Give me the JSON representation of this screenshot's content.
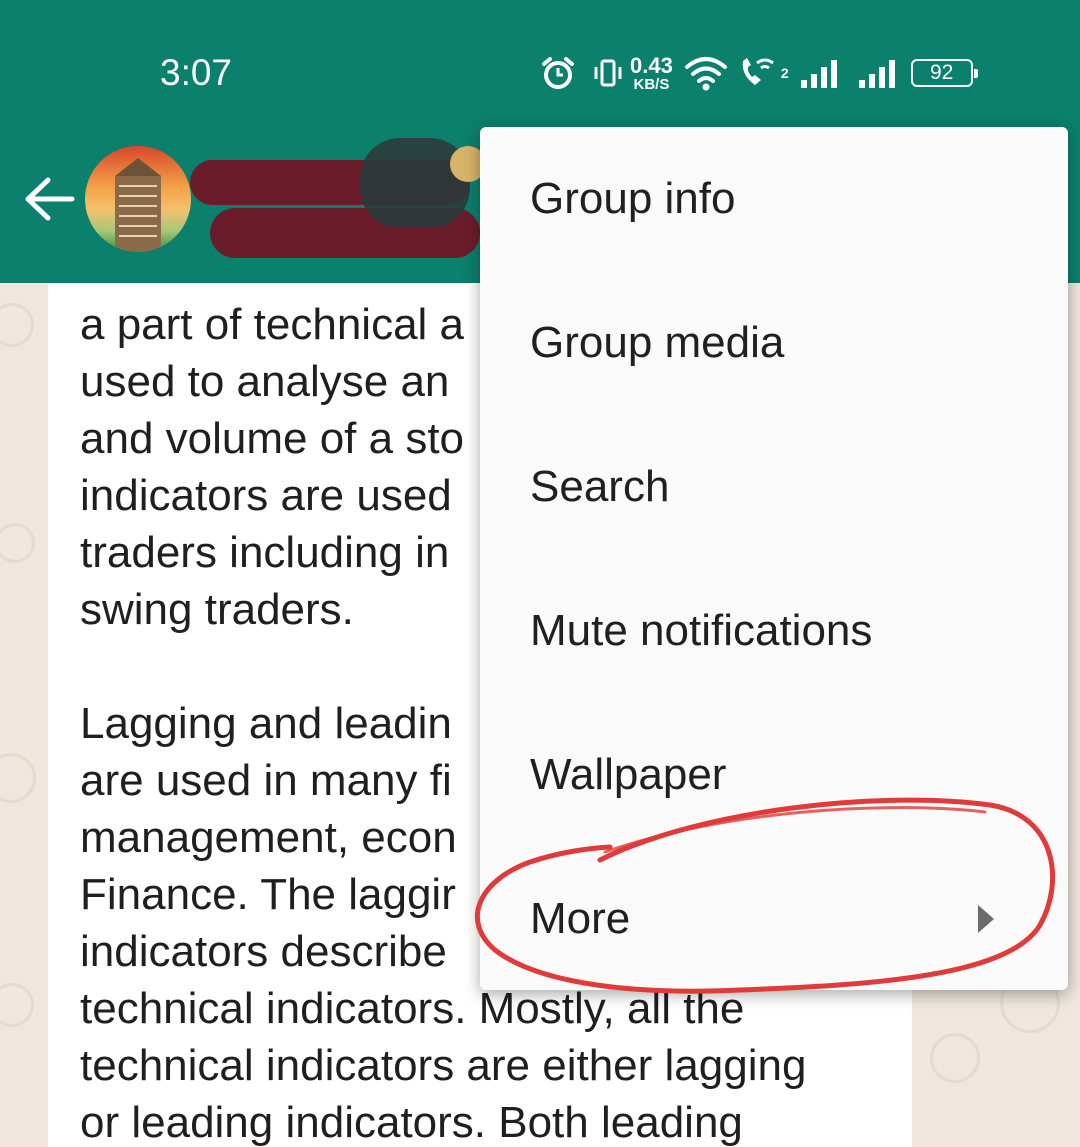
{
  "status_bar": {
    "time": "3:07",
    "net_speed_value": "0.43",
    "net_speed_unit": "KB/S",
    "battery_level": "92",
    "sim_label": "2"
  },
  "toolbar": {
    "back_icon": "arrow-left-icon"
  },
  "message": {
    "text": "a part of technical a\nused to analyse an\nand volume of a sto\nindicators are used\ntraders including in\nswing traders.\n\nLagging and leadin\nare used in many fi\nmanagement, econ\nFinance. The laggir\nindicators describe\ntechnical indicators. Mostly, all the\ntechnical indicators are either lagging\nor leading indicators. Both leading"
  },
  "menu": {
    "items": [
      {
        "label": "Group info"
      },
      {
        "label": "Group media"
      },
      {
        "label": "Search"
      },
      {
        "label": "Mute notifications"
      },
      {
        "label": "Wallpaper"
      },
      {
        "label": "More",
        "submenu_icon": "chevron-right-icon"
      }
    ]
  },
  "colors": {
    "header": "#0b806d",
    "menu_background": "#fafafa",
    "annotation_circle": "#e03a3a",
    "chat_background": "#efe7dd"
  }
}
